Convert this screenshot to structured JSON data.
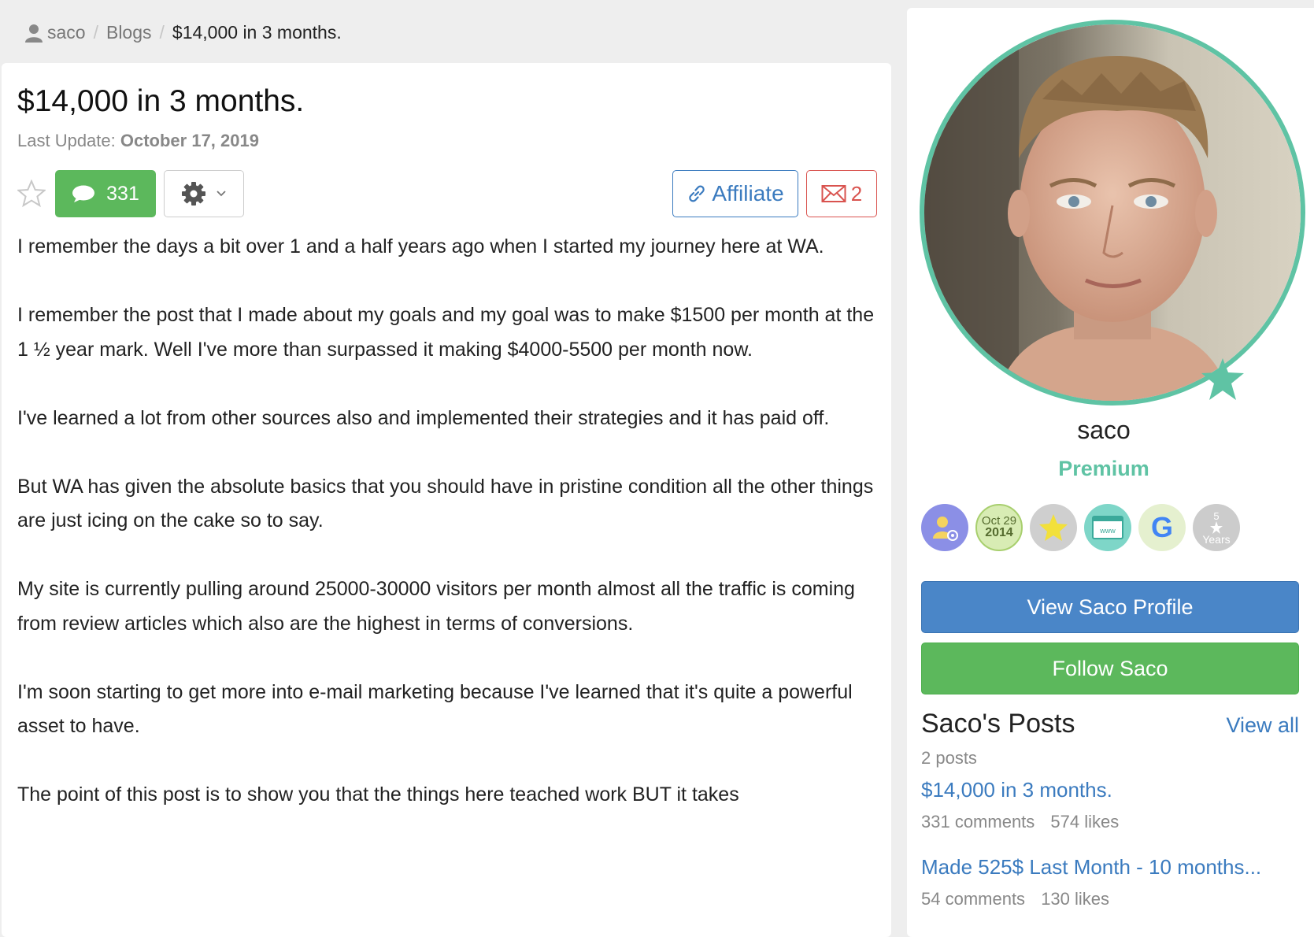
{
  "breadcrumb": {
    "user": "saco",
    "section": "Blogs",
    "current": "$14,000 in 3 months.",
    "separator": "/"
  },
  "post": {
    "title": "$14,000 in 3 months.",
    "last_update_label": "Last Update:",
    "last_update_date": "October 17, 2019",
    "comments_count": "331",
    "affiliate_label": "Affiliate",
    "messages_count": "2",
    "paragraphs": [
      "I remember the days a bit over 1 and a half years ago when I started my journey here at WA.",
      "I remember the post that I made about my goals and my goal was to make $1500 per month at the 1 ½ year mark. Well I've more than surpassed it making $4000-5500 per month now.",
      "I've learned a lot from other sources also and implemented their strategies and it has paid off.",
      "But WA has given the absolute basics that you should have in pristine condition all the other things are just icing on the cake so to say.",
      "My site is currently pulling around 25000-30000 visitors per month almost all the traffic is coming from review articles which also are the highest in terms of conversions.",
      "I'm soon starting to get more into e-mail marketing because I've learned that it's quite a powerful asset to have.",
      "The point of this post is to show you that the things here teached work BUT it takes"
    ]
  },
  "sidebar": {
    "name": "saco",
    "level": "Premium",
    "badges": {
      "date_month": "Oct 29",
      "date_year": "2014",
      "www": "www",
      "google": "G",
      "years_number": "5",
      "years_label": "Years"
    },
    "view_profile_label": "View Saco Profile",
    "follow_label": "Follow Saco",
    "posts_title": "Saco's Posts",
    "view_all_label": "View all",
    "posts_count": "2 posts",
    "posts": [
      {
        "title": "$14,000 in 3 months.",
        "comments": "331 comments",
        "likes": "574 likes"
      },
      {
        "title": "Made 525$ Last Month - 10 months...",
        "comments": "54 comments",
        "likes": "130 likes"
      }
    ]
  },
  "colors": {
    "accent_green": "#5cb85c",
    "accent_blue": "#4a86c8",
    "link_blue": "#3b7bbf",
    "premium_teal": "#5fc3a4",
    "mail_red": "#d9534f"
  }
}
